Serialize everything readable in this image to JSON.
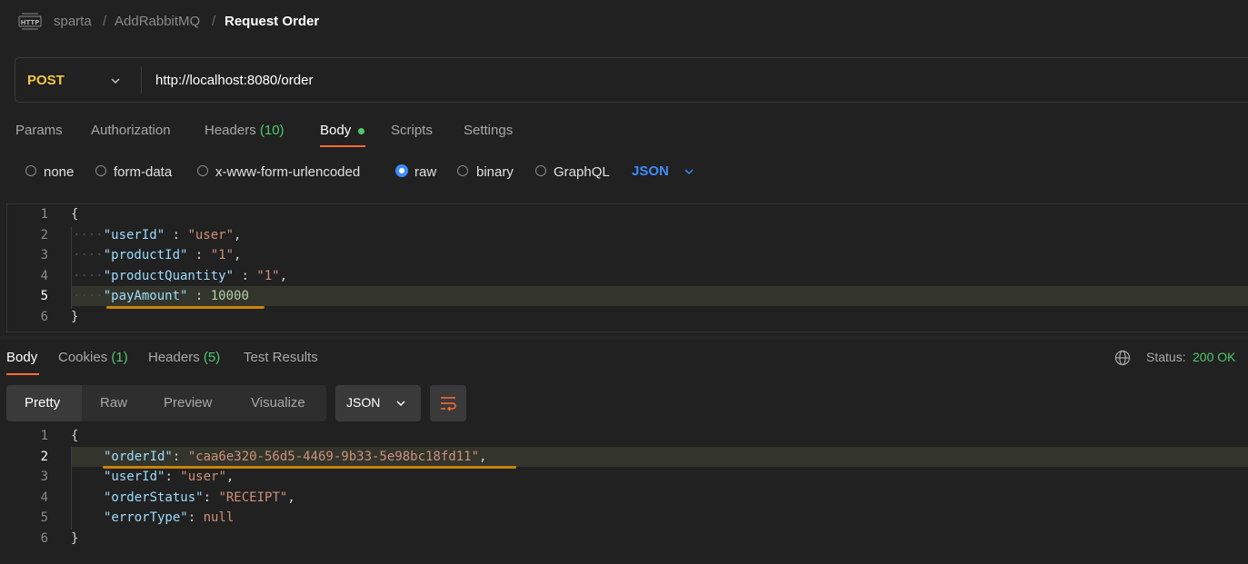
{
  "breadcrumb": {
    "icon": "http-icon",
    "items": [
      "sparta",
      "AddRabbitMQ",
      "Request Order"
    ],
    "separator": "/"
  },
  "request": {
    "method": "POST",
    "url": "http://localhost:8080/order"
  },
  "request_tabs": {
    "params": "Params",
    "authorization": "Authorization",
    "headers": "Headers",
    "headers_count": "(10)",
    "body": "Body",
    "scripts": "Scripts",
    "settings": "Settings"
  },
  "body_types": {
    "none": "none",
    "form_data": "form-data",
    "urlencoded": "x-www-form-urlencoded",
    "raw": "raw",
    "binary": "binary",
    "graphql": "GraphQL",
    "selected": "raw",
    "language": "JSON"
  },
  "request_body": {
    "line_numbers": [
      "1",
      "2",
      "3",
      "4",
      "5",
      "6"
    ],
    "open_brace": "{",
    "close_brace": "}",
    "k1": "\"userId\"",
    "v1": "\"user\"",
    "k2": "\"productId\"",
    "v2": "\"1\"",
    "k3": "\"productQuantity\"",
    "v3": "\"1\"",
    "k4": "\"payAmount\"",
    "v4": "10000"
  },
  "response_tabs": {
    "body": "Body",
    "cookies": "Cookies",
    "cookies_count": "(1)",
    "headers": "Headers",
    "headers_count": "(5)",
    "test_results": "Test Results"
  },
  "status": {
    "label": "Status:",
    "value": "200 OK"
  },
  "view_modes": {
    "pretty": "Pretty",
    "raw": "Raw",
    "preview": "Preview",
    "visualize": "Visualize",
    "format": "JSON"
  },
  "response_body": {
    "line_numbers": [
      "1",
      "2",
      "3",
      "4",
      "5",
      "6"
    ],
    "open_brace": "{",
    "close_brace": "}",
    "k1": "\"orderId\"",
    "v1": "\"caa6e320-56d5-4469-9b33-5e98bc18fd11\"",
    "k2": "\"userId\"",
    "v2": "\"user\"",
    "k3": "\"orderStatus\"",
    "v3": "\"RECEIPT\"",
    "k4": "\"errorType\"",
    "v4": "null"
  },
  "colors": {
    "accent": "#ff6c37",
    "method": "#f5c842",
    "success": "#4ec96b",
    "link": "#3d8bfd",
    "highlight_underline": "#c8840e"
  }
}
